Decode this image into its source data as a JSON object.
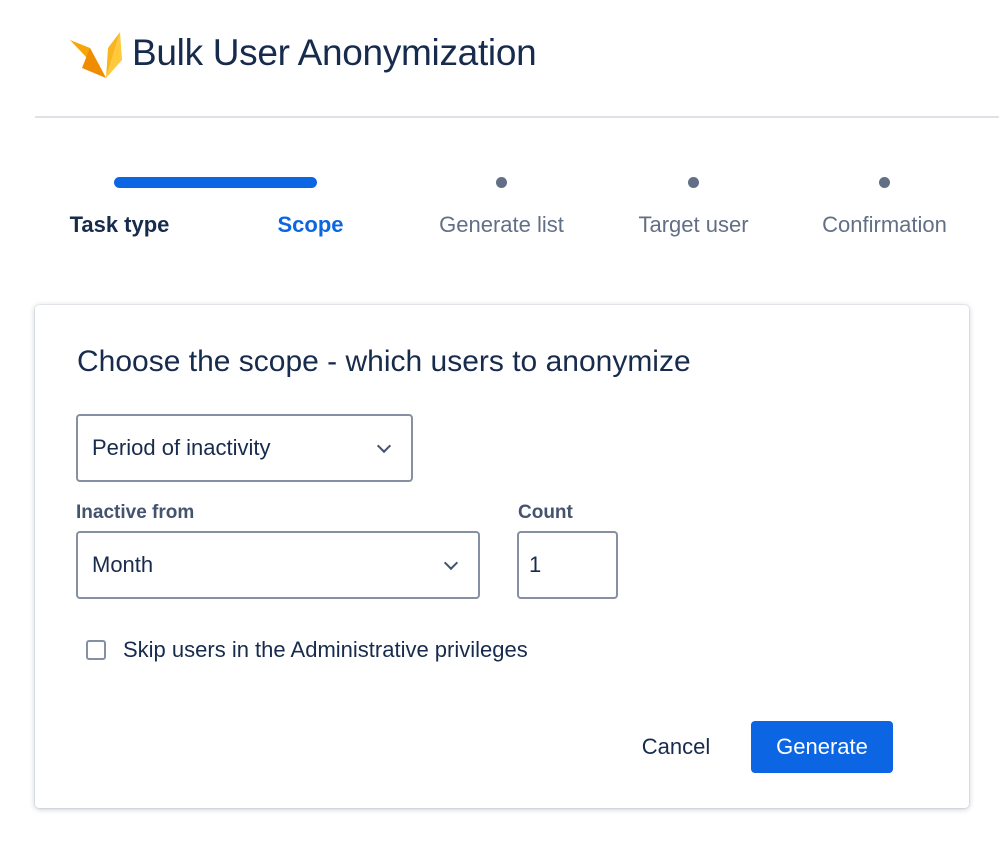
{
  "header": {
    "title": "Bulk User Anonymization",
    "logo_icon": "origami-bird-logo"
  },
  "stepper": {
    "progress_fraction": 0.25,
    "steps": [
      {
        "label": "Task type",
        "state": "done"
      },
      {
        "label": "Scope",
        "state": "active"
      },
      {
        "label": "Generate list",
        "state": "pending"
      },
      {
        "label": "Target user",
        "state": "pending"
      },
      {
        "label": "Confirmation",
        "state": "pending"
      }
    ]
  },
  "form": {
    "heading": "Choose the scope - which users to anonymize",
    "scope_select": {
      "value": "Period of inactivity"
    },
    "inactive_from": {
      "label": "Inactive from",
      "value": "Month"
    },
    "count": {
      "label": "Count",
      "value": "1"
    },
    "skip_admins": {
      "label": "Skip users in the Administrative privileges",
      "checked": false
    },
    "cancel_label": "Cancel",
    "generate_label": "Generate"
  },
  "colors": {
    "accent": "#0c66e4",
    "text": "#172b4d",
    "muted": "#626f86"
  }
}
